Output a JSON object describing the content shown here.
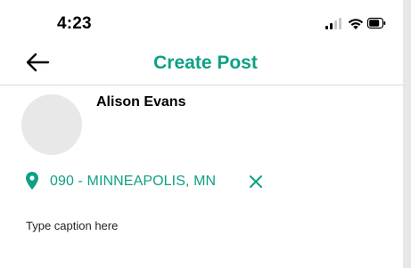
{
  "status_bar": {
    "time": "4:23",
    "icons": [
      "cellular-signal-icon",
      "wifi-icon",
      "battery-icon"
    ]
  },
  "header": {
    "back_icon": "arrow-left-icon",
    "title": "Create Post"
  },
  "user": {
    "name": "Alison Evans"
  },
  "location": {
    "icon": "location-pin-icon",
    "text": "090 - MINNEAPOLIS, MN",
    "clear_icon": "close-icon"
  },
  "caption": {
    "placeholder": "Type caption here"
  },
  "colors": {
    "accent": "#0ea183",
    "divider": "#dddddd",
    "avatar_placeholder": "#e8e8e8"
  }
}
